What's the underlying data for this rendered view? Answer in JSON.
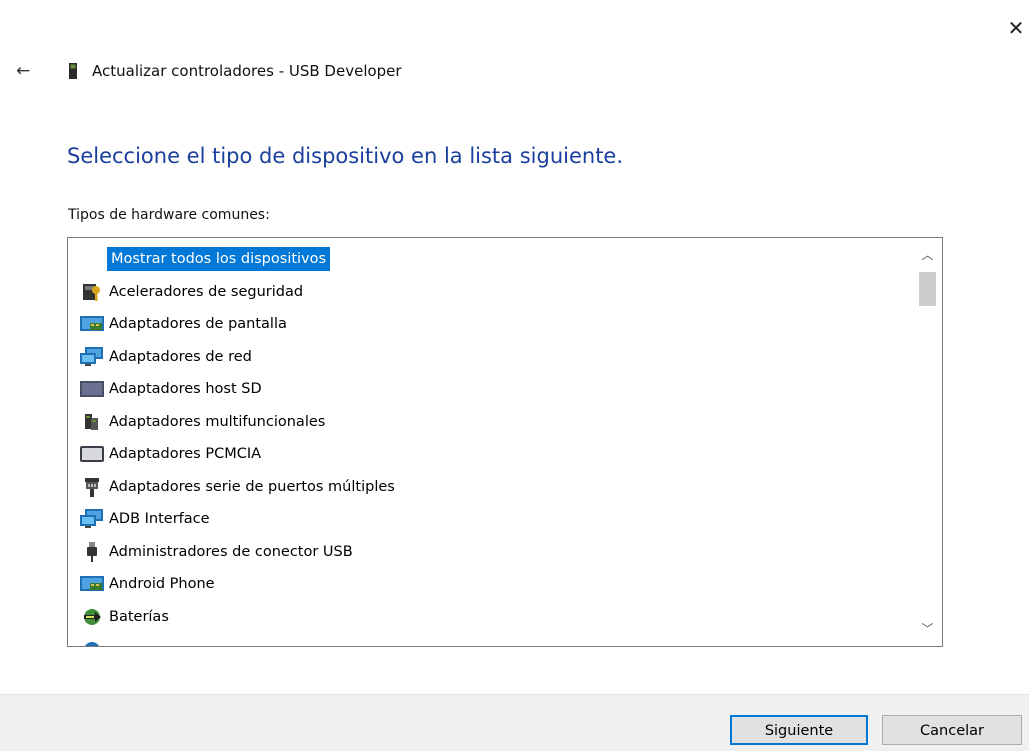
{
  "window": {
    "title": "Actualizar controladores - USB Developer",
    "close_glyph": "✕",
    "back_glyph": "←"
  },
  "main": {
    "heading": "Seleccione el tipo de dispositivo en la lista siguiente.",
    "list_label": "Tipos de hardware comunes:"
  },
  "list": {
    "items": [
      {
        "label": "Mostrar todos los dispositivos",
        "icon": "none",
        "selected": true
      },
      {
        "label": "Aceleradores de seguridad",
        "icon": "security-accelerator-icon"
      },
      {
        "label": "Adaptadores de pantalla",
        "icon": "display-adapter-icon"
      },
      {
        "label": "Adaptadores de red",
        "icon": "network-adapter-icon"
      },
      {
        "label": "Adaptadores host SD",
        "icon": "sd-host-adapter-icon"
      },
      {
        "label": "Adaptadores multifuncionales",
        "icon": "multifunction-adapter-icon"
      },
      {
        "label": "Adaptadores PCMCIA",
        "icon": "pcmcia-adapter-icon"
      },
      {
        "label": "Adaptadores serie de puertos múltiples",
        "icon": "multiport-serial-icon"
      },
      {
        "label": "ADB Interface",
        "icon": "adb-interface-icon"
      },
      {
        "label": "Administradores de conector USB",
        "icon": "usb-connector-icon"
      },
      {
        "label": "Android Phone",
        "icon": "android-phone-icon"
      },
      {
        "label": "Baterías",
        "icon": "battery-icon"
      }
    ],
    "scroll_up_glyph": "︿",
    "scroll_down_glyph": "﹀"
  },
  "footer": {
    "next_label": "Siguiente",
    "cancel_label": "Cancelar"
  },
  "colors": {
    "heading": "#1a3f9e",
    "selection": "#0078d7",
    "footer_bg": "#f0f0f0"
  }
}
